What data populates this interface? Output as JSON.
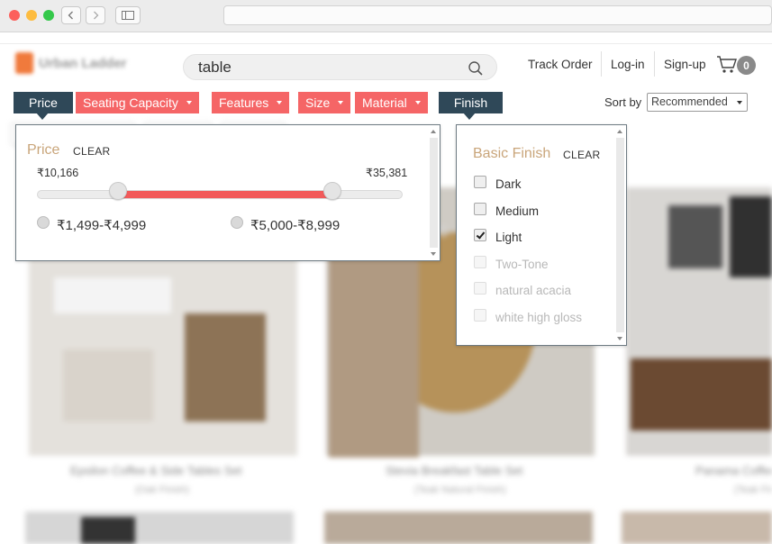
{
  "search": {
    "value": "table"
  },
  "header": {
    "logo_text": "Urban Ladder",
    "links": [
      "Track Order",
      "Log-in",
      "Sign-up"
    ],
    "cart_count": "0"
  },
  "filters": [
    {
      "label": "Price",
      "state": "active"
    },
    {
      "label": "Seating Capacity",
      "state": "dropdown"
    },
    {
      "label": "Features",
      "state": "dropdown"
    },
    {
      "label": "Size",
      "state": "dropdown"
    },
    {
      "label": "Material",
      "state": "dropdown"
    },
    {
      "label": "Finish",
      "state": "active"
    }
  ],
  "sort": {
    "label": "Sort by",
    "selected": "Recommended"
  },
  "price_panel": {
    "title": "Price",
    "clear_label": "CLEAR",
    "min_label": "₹10,166",
    "max_label": "₹35,381",
    "min_fraction": 0.222,
    "max_fraction": 0.807,
    "ranges": [
      "₹1,499-₹4,999",
      "₹5,000-₹8,999"
    ]
  },
  "finish_panel": {
    "title": "Basic Finish",
    "clear_label": "CLEAR",
    "options": [
      {
        "label": "Dark",
        "checked": false,
        "enabled": true
      },
      {
        "label": "Medium",
        "checked": false,
        "enabled": true
      },
      {
        "label": "Light",
        "checked": true,
        "enabled": true
      },
      {
        "label": "Two-Tone",
        "checked": false,
        "enabled": false
      },
      {
        "label": "natural acacia",
        "checked": false,
        "enabled": false
      },
      {
        "label": "white high gloss",
        "checked": false,
        "enabled": false
      }
    ]
  },
  "products": [
    {
      "name": "Epsilon Coffee & Side Tables Set",
      "finish": "(Oak Finish)"
    },
    {
      "name": "Stevia Breakfast Table Set",
      "finish": "(Teak Natural Finish)"
    },
    {
      "name": "Panama Coffee Table",
      "finish": "(Teak Finish)"
    }
  ],
  "colors": {
    "accent": "#f56566",
    "dark": "#2f4858",
    "title_gold": "#c9a57a"
  }
}
